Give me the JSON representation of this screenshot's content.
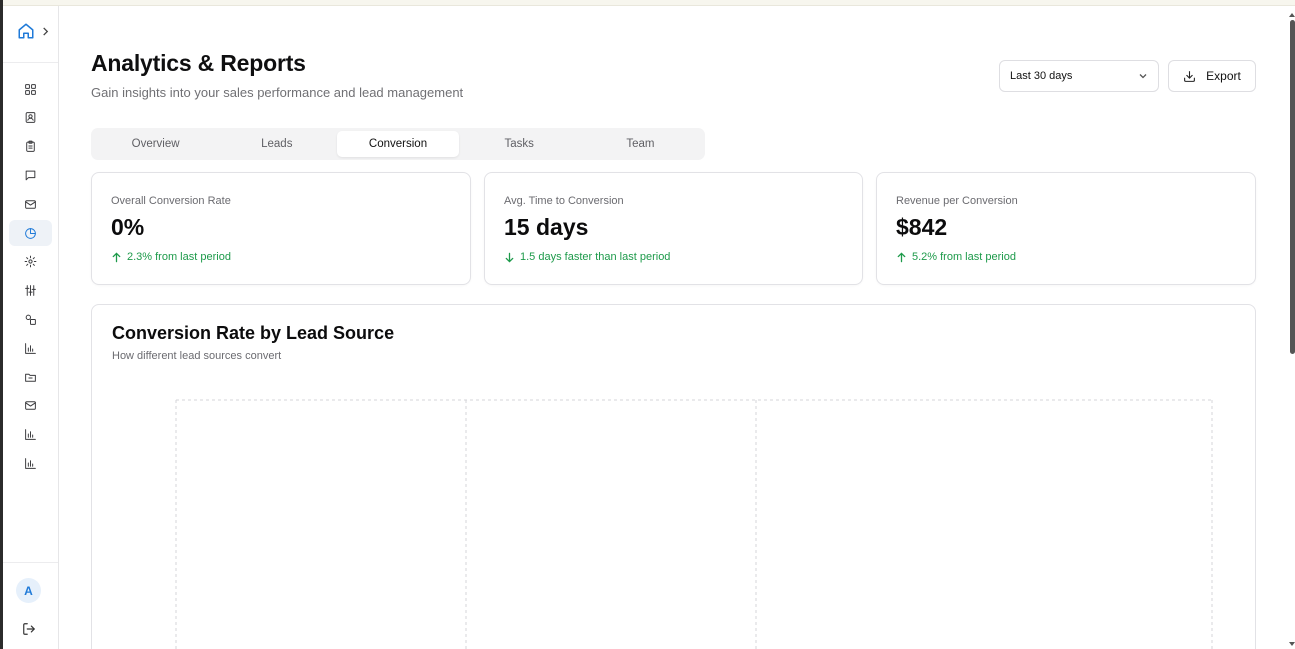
{
  "sidebar": {
    "items": [
      {
        "icon": "dashboard-grid-icon",
        "active": false
      },
      {
        "icon": "contacts-icon",
        "active": false
      },
      {
        "icon": "clipboard-icon",
        "active": false
      },
      {
        "icon": "chat-bubble-icon",
        "active": false
      },
      {
        "icon": "mail-icon",
        "active": false
      },
      {
        "icon": "pie-chart-icon",
        "active": true
      },
      {
        "icon": "settings-gear-icon",
        "active": false
      },
      {
        "icon": "sliders-icon",
        "active": false
      },
      {
        "icon": "integrations-icon",
        "active": false
      },
      {
        "icon": "bar-chart-icon",
        "active": false
      },
      {
        "icon": "folder-icon",
        "active": false
      },
      {
        "icon": "mail-icon",
        "active": false
      },
      {
        "icon": "bar-chart-icon",
        "active": false
      },
      {
        "icon": "bar-chart-icon",
        "active": false
      }
    ],
    "avatar_initial": "A"
  },
  "header": {
    "title": "Analytics & Reports",
    "subtitle": "Gain insights into your sales performance and lead management",
    "range_select_value": "Last 30 days",
    "export_label": "Export"
  },
  "tabs": [
    {
      "label": "Overview",
      "active": false
    },
    {
      "label": "Leads",
      "active": false
    },
    {
      "label": "Conversion",
      "active": true
    },
    {
      "label": "Tasks",
      "active": false
    },
    {
      "label": "Team",
      "active": false
    }
  ],
  "stats": [
    {
      "label": "Overall Conversion Rate",
      "value": "0%",
      "delta": "2.3% from last period",
      "direction": "up"
    },
    {
      "label": "Avg. Time to Conversion",
      "value": "15 days",
      "delta": "1.5 days faster than last period",
      "direction": "down"
    },
    {
      "label": "Revenue per Conversion",
      "value": "$842",
      "delta": "5.2% from last period",
      "direction": "up"
    }
  ],
  "chart_section": {
    "title": "Conversion Rate by Lead Source",
    "subtitle": "How different lead sources convert"
  },
  "colors": {
    "accent": "#1f7ad8",
    "positive": "#1d9a4a",
    "grid": "#d6d6da"
  },
  "chart_data": {
    "type": "bar",
    "title": "",
    "categories": [],
    "values": [],
    "grid": true
  }
}
